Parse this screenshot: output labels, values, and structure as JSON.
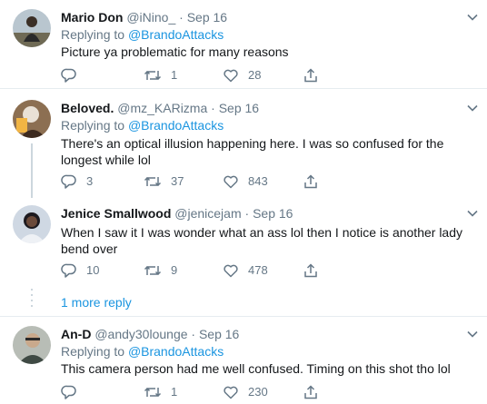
{
  "tweets": [
    {
      "name": "Mario Don",
      "handle": "@iNino_",
      "date": "Sep 16",
      "reply_prefix": "Replying to",
      "reply_to": "@BrandoAttacks",
      "text": "Picture ya problematic for many reasons",
      "replies": "",
      "retweets": "1",
      "likes": "28"
    },
    {
      "name": "Beloved.",
      "handle": "@mz_KARizma",
      "date": "Sep 16",
      "reply_prefix": "Replying to",
      "reply_to": "@BrandoAttacks",
      "text": "There's an optical illusion happening here. I was so confused for the longest while lol",
      "replies": "3",
      "retweets": "37",
      "likes": "843"
    },
    {
      "name": "Jenice Smallwood",
      "handle": "@jenicejam",
      "date": "Sep 16",
      "text": "When I saw it I was wonder what an ass lol then I notice is another lady bend over",
      "replies": "10",
      "retweets": "9",
      "likes": "478"
    },
    {
      "name": "An-D",
      "handle": "@andy30lounge",
      "date": "Sep 16",
      "reply_prefix": "Replying to",
      "reply_to": "@BrandoAttacks",
      "text": "This camera person had me well confused. Timing on this shot tho lol",
      "replies": "",
      "retweets": "1",
      "likes": "230"
    }
  ],
  "more_replies": "1 more reply",
  "dot": "·",
  "colors": {
    "link": "#1b95e0",
    "muted": "#657786",
    "divider": "#e6ecf0",
    "thread_line": "#ccd6dd"
  }
}
